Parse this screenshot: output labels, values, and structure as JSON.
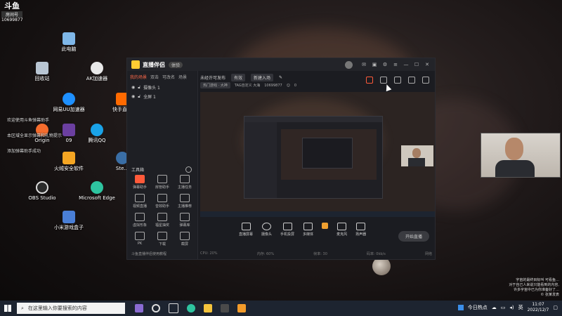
{
  "desktop": {
    "top_badge": {
      "title": "斗鱼",
      "subtitle": "房间号",
      "room_id": "10699877"
    },
    "icons": [
      {
        "label": "此电脑",
        "icon": "computer-icon",
        "color": "#7fb7e8"
      },
      {
        "label": "回收站",
        "icon": "recycle-bin-icon",
        "color": "#b9c6d3"
      },
      {
        "label": "AK加速器",
        "icon": "ak-accelerator-icon",
        "color": "#e8e8e8"
      },
      {
        "label": "网易UU加速器",
        "icon": "uu-accelerator-icon",
        "color": "#1e90ff"
      },
      {
        "label": "快手直播",
        "icon": "kuaishou-icon",
        "color": "#ff6a00"
      },
      {
        "label": "Origin",
        "icon": "origin-icon",
        "color": "#f56c2d"
      },
      {
        "label": "09",
        "icon": "app-icon",
        "color": "#6b3fa0"
      },
      {
        "label": "腾讯QQ",
        "icon": "qq-icon",
        "color": "#1aa3e8"
      },
      {
        "label": "火绒安全软件",
        "icon": "huorong-icon",
        "color": "#f5a623"
      },
      {
        "label": "Ste...",
        "icon": "steam-icon",
        "color": "#3a6ea5"
      },
      {
        "label": "OBS Studio",
        "icon": "obs-icon",
        "color": "#2b2b2b"
      },
      {
        "label": "Microsoft Edge",
        "icon": "edge-icon",
        "color": "#2ec4a0"
      },
      {
        "label": "小米游戏盒子",
        "icon": "mi-game-box-icon",
        "color": "#4a7fd6"
      }
    ],
    "overlay_lines": [
      "欢迎使用斗鱼弹幕助手",
      "本区域全显示弹幕和礼物提示",
      "添加弹幕助手成功"
    ],
    "bottom_right_text": [
      "宇宙的最终目标叫 可看鱼…",
      "对于自己人来说只能看到的内容,",
      "许多宇宙中已为你准备好了…",
      "© 张某发表"
    ]
  },
  "app": {
    "name": "直播伴侣",
    "version_label": "体验",
    "sidebar_tabs": [
      "我的场景",
      "双击",
      "可改名",
      "场景"
    ],
    "scenes": [
      "摄像头 1",
      "全屏 1"
    ],
    "tools_title": "工具箱",
    "tools": [
      "弹幕助手",
      "房管助手",
      "主播任务",
      "视频直播",
      "音效助手",
      "主播推荐",
      "虚拟形象",
      "福星抽奖",
      "弹幕库",
      "PK",
      "下载",
      "截屏"
    ],
    "sidebar_footer": "斗鱼直播伴侣使用教程",
    "topline": [
      "未经许可发布",
      "有效",
      "新建入场"
    ],
    "topline2": [
      "热门游戏 · 大神",
      "TAG自定义 大海",
      "10699877",
      "0"
    ],
    "bottom_tools": [
      "直播屏幕",
      "摄像头",
      "手机投屏",
      "多媒体",
      "麦克风",
      "扬声器"
    ],
    "start_label": "开始直播",
    "status_items": [
      "CPU: 20%",
      "内存: 60%",
      "帧率: 30",
      "码率: 0kb/s",
      "网络"
    ]
  },
  "taskbar": {
    "search_placeholder": "在这里输入你要搜索的内容",
    "hot_news": "今日热点",
    "ime": "英",
    "time": "11:07",
    "date": "2022/12/7"
  }
}
